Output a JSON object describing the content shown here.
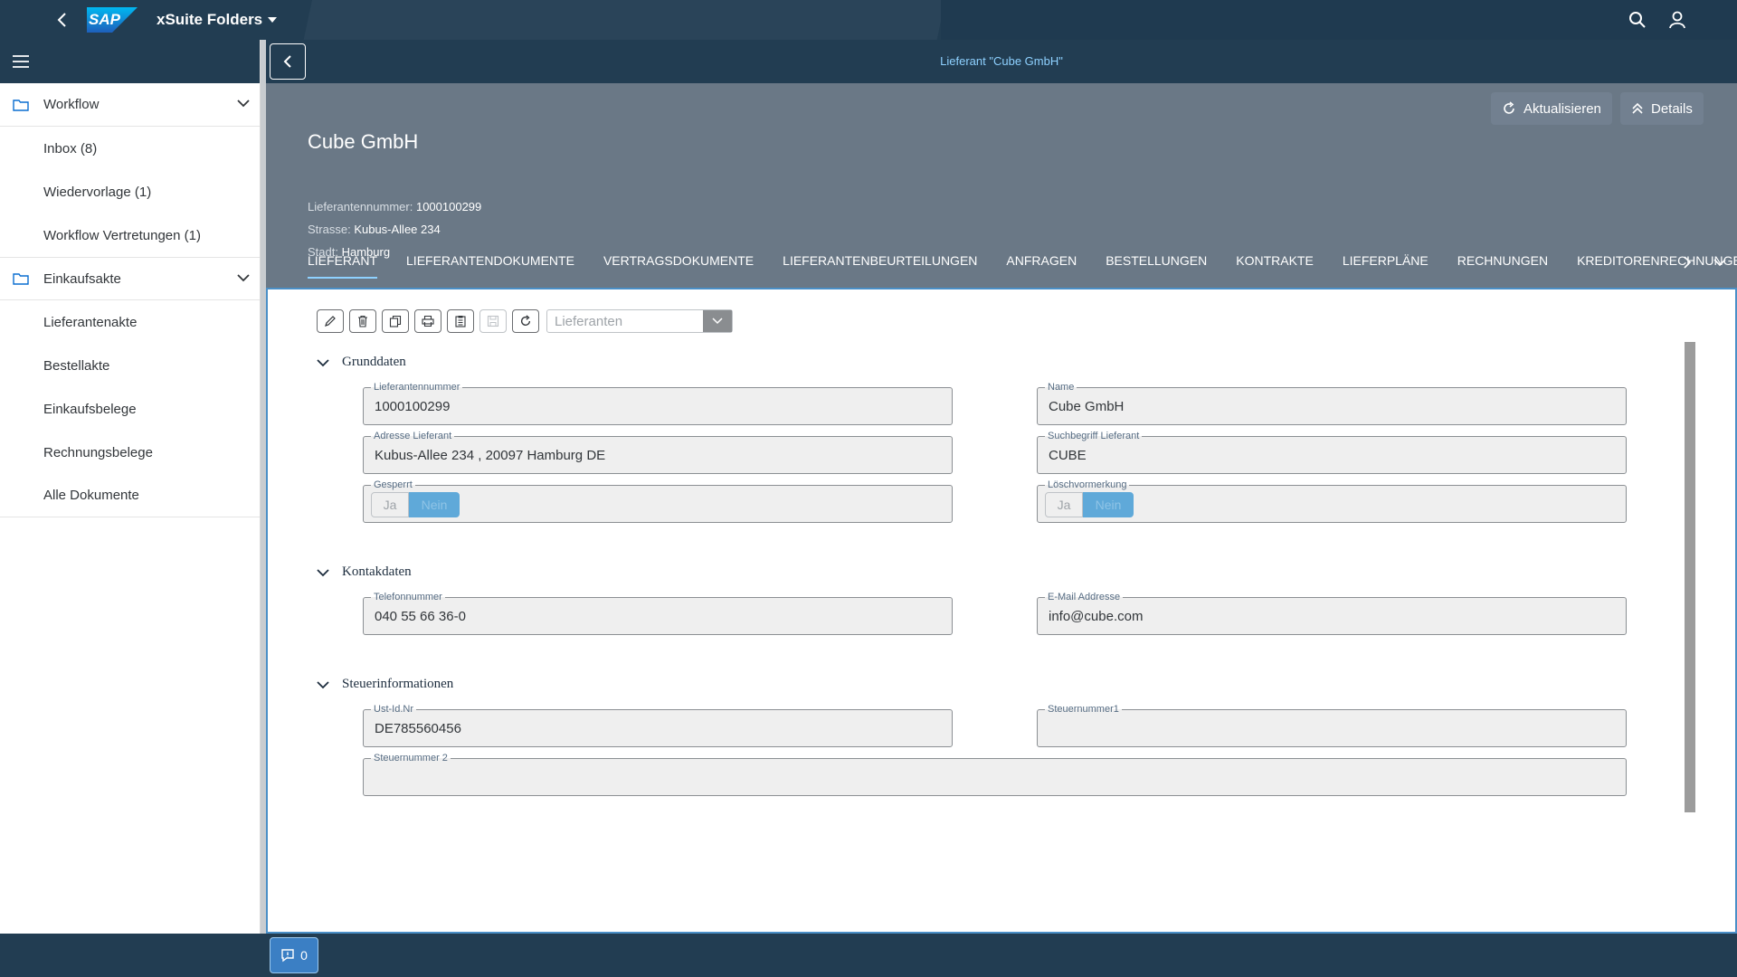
{
  "shell": {
    "app_title": "xSuite Folders",
    "logo_text": "SAP",
    "colors": {
      "shell_bg": "#223d52",
      "accent": "#8ed1ff",
      "header_bg": "#6a7886"
    }
  },
  "sidebar": {
    "groups": [
      {
        "label": "Workflow",
        "items": [
          "Inbox (8)",
          "Wiedervorlage (1)",
          "Workflow Vertretungen (1)"
        ]
      },
      {
        "label": "Einkaufsakte",
        "items": [
          "Lieferantenakte",
          "Bestellakte",
          "Einkaufsbelege",
          "Rechnungsbelege",
          "Alle Dokumente"
        ]
      }
    ]
  },
  "page": {
    "nav_title": "Lieferant \"Cube GmbH\"",
    "object_title": "Cube GmbH",
    "attributes": [
      {
        "key": "Lieferantennummer:",
        "value": "1000100299"
      },
      {
        "key": "Strasse:",
        "value": "Kubus-Allee 234"
      },
      {
        "key": "Stadt:",
        "value": "Hamburg"
      }
    ],
    "actions": {
      "refresh": "Aktualisieren",
      "details": "Details"
    },
    "tabs": [
      "LIEFERANT",
      "LIEFERANTENDOKUMENTE",
      "VERTRAGSDOKUMENTE",
      "LIEFERANTENBEURTEILUNGEN",
      "ANFRAGEN",
      "BESTELLUNGEN",
      "KONTRAKTE",
      "LIEFERPLÄNE",
      "RECHNUNGEN",
      "KREDITORENRECHNUNGEN"
    ],
    "active_tab": "LIEFERANT"
  },
  "toolbar": {
    "icons": [
      "edit-icon",
      "delete-icon",
      "copy-icon",
      "print-icon",
      "clipboard-icon",
      "save-icon",
      "refresh-icon"
    ],
    "combo_placeholder": "Lieferanten"
  },
  "sections": {
    "grunddaten": {
      "title": "Grunddaten",
      "lieferantennummer": {
        "label": "Lieferantennummer",
        "value": "1000100299"
      },
      "name": {
        "label": "Name",
        "value": "Cube GmbH"
      },
      "adresse": {
        "label": "Adresse Lieferant",
        "value": "Kubus-Allee 234 , 20097 Hamburg DE"
      },
      "suchbegriff": {
        "label": "Suchbegriff Lieferant",
        "value": "CUBE"
      },
      "gesperrt": {
        "label": "Gesperrt",
        "yes": "Ja",
        "no": "Nein",
        "selected": "Nein"
      },
      "loeschvormerkung": {
        "label": "Löschvormerkung",
        "yes": "Ja",
        "no": "Nein",
        "selected": "Nein"
      }
    },
    "kontaktdaten": {
      "title": "Kontakdaten",
      "telefon": {
        "label": "Telefonnummer",
        "value": "040 55 66 36-0"
      },
      "email": {
        "label": "E-Mail Addresse",
        "value": "info@cube.com"
      }
    },
    "steuer": {
      "title": "Steuerinformationen",
      "ustid": {
        "label": "Ust-Id.Nr",
        "value": "DE785560456"
      },
      "steuernummer1": {
        "label": "Steuernummer1",
        "value": ""
      },
      "steuernummer2": {
        "label": "Steuernummer 2",
        "value": ""
      }
    }
  },
  "footer": {
    "message_count": "0"
  }
}
